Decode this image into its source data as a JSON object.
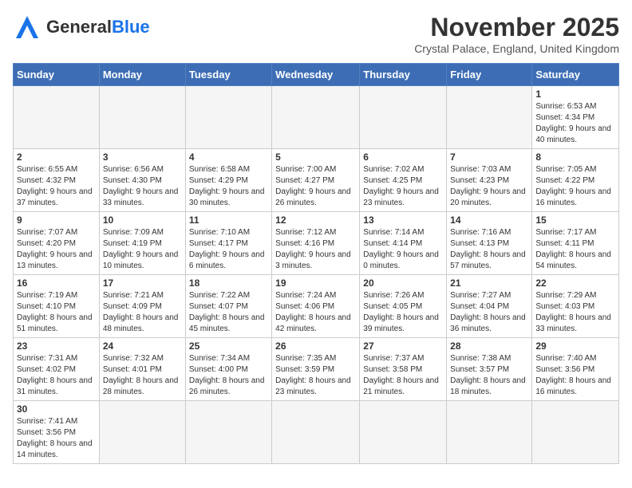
{
  "header": {
    "logo_general": "General",
    "logo_blue": "Blue",
    "month_title": "November 2025",
    "subtitle": "Crystal Palace, England, United Kingdom"
  },
  "days_of_week": [
    "Sunday",
    "Monday",
    "Tuesday",
    "Wednesday",
    "Thursday",
    "Friday",
    "Saturday"
  ],
  "weeks": [
    [
      {
        "day": "",
        "info": ""
      },
      {
        "day": "",
        "info": ""
      },
      {
        "day": "",
        "info": ""
      },
      {
        "day": "",
        "info": ""
      },
      {
        "day": "",
        "info": ""
      },
      {
        "day": "",
        "info": ""
      },
      {
        "day": "1",
        "info": "Sunrise: 6:53 AM\nSunset: 4:34 PM\nDaylight: 9 hours and 40 minutes."
      }
    ],
    [
      {
        "day": "2",
        "info": "Sunrise: 6:55 AM\nSunset: 4:32 PM\nDaylight: 9 hours and 37 minutes."
      },
      {
        "day": "3",
        "info": "Sunrise: 6:56 AM\nSunset: 4:30 PM\nDaylight: 9 hours and 33 minutes."
      },
      {
        "day": "4",
        "info": "Sunrise: 6:58 AM\nSunset: 4:29 PM\nDaylight: 9 hours and 30 minutes."
      },
      {
        "day": "5",
        "info": "Sunrise: 7:00 AM\nSunset: 4:27 PM\nDaylight: 9 hours and 26 minutes."
      },
      {
        "day": "6",
        "info": "Sunrise: 7:02 AM\nSunset: 4:25 PM\nDaylight: 9 hours and 23 minutes."
      },
      {
        "day": "7",
        "info": "Sunrise: 7:03 AM\nSunset: 4:23 PM\nDaylight: 9 hours and 20 minutes."
      },
      {
        "day": "8",
        "info": "Sunrise: 7:05 AM\nSunset: 4:22 PM\nDaylight: 9 hours and 16 minutes."
      }
    ],
    [
      {
        "day": "9",
        "info": "Sunrise: 7:07 AM\nSunset: 4:20 PM\nDaylight: 9 hours and 13 minutes."
      },
      {
        "day": "10",
        "info": "Sunrise: 7:09 AM\nSunset: 4:19 PM\nDaylight: 9 hours and 10 minutes."
      },
      {
        "day": "11",
        "info": "Sunrise: 7:10 AM\nSunset: 4:17 PM\nDaylight: 9 hours and 6 minutes."
      },
      {
        "day": "12",
        "info": "Sunrise: 7:12 AM\nSunset: 4:16 PM\nDaylight: 9 hours and 3 minutes."
      },
      {
        "day": "13",
        "info": "Sunrise: 7:14 AM\nSunset: 4:14 PM\nDaylight: 9 hours and 0 minutes."
      },
      {
        "day": "14",
        "info": "Sunrise: 7:16 AM\nSunset: 4:13 PM\nDaylight: 8 hours and 57 minutes."
      },
      {
        "day": "15",
        "info": "Sunrise: 7:17 AM\nSunset: 4:11 PM\nDaylight: 8 hours and 54 minutes."
      }
    ],
    [
      {
        "day": "16",
        "info": "Sunrise: 7:19 AM\nSunset: 4:10 PM\nDaylight: 8 hours and 51 minutes."
      },
      {
        "day": "17",
        "info": "Sunrise: 7:21 AM\nSunset: 4:09 PM\nDaylight: 8 hours and 48 minutes."
      },
      {
        "day": "18",
        "info": "Sunrise: 7:22 AM\nSunset: 4:07 PM\nDaylight: 8 hours and 45 minutes."
      },
      {
        "day": "19",
        "info": "Sunrise: 7:24 AM\nSunset: 4:06 PM\nDaylight: 8 hours and 42 minutes."
      },
      {
        "day": "20",
        "info": "Sunrise: 7:26 AM\nSunset: 4:05 PM\nDaylight: 8 hours and 39 minutes."
      },
      {
        "day": "21",
        "info": "Sunrise: 7:27 AM\nSunset: 4:04 PM\nDaylight: 8 hours and 36 minutes."
      },
      {
        "day": "22",
        "info": "Sunrise: 7:29 AM\nSunset: 4:03 PM\nDaylight: 8 hours and 33 minutes."
      }
    ],
    [
      {
        "day": "23",
        "info": "Sunrise: 7:31 AM\nSunset: 4:02 PM\nDaylight: 8 hours and 31 minutes."
      },
      {
        "day": "24",
        "info": "Sunrise: 7:32 AM\nSunset: 4:01 PM\nDaylight: 8 hours and 28 minutes."
      },
      {
        "day": "25",
        "info": "Sunrise: 7:34 AM\nSunset: 4:00 PM\nDaylight: 8 hours and 26 minutes."
      },
      {
        "day": "26",
        "info": "Sunrise: 7:35 AM\nSunset: 3:59 PM\nDaylight: 8 hours and 23 minutes."
      },
      {
        "day": "27",
        "info": "Sunrise: 7:37 AM\nSunset: 3:58 PM\nDaylight: 8 hours and 21 minutes."
      },
      {
        "day": "28",
        "info": "Sunrise: 7:38 AM\nSunset: 3:57 PM\nDaylight: 8 hours and 18 minutes."
      },
      {
        "day": "29",
        "info": "Sunrise: 7:40 AM\nSunset: 3:56 PM\nDaylight: 8 hours and 16 minutes."
      }
    ],
    [
      {
        "day": "30",
        "info": "Sunrise: 7:41 AM\nSunset: 3:56 PM\nDaylight: 8 hours and 14 minutes."
      },
      {
        "day": "",
        "info": ""
      },
      {
        "day": "",
        "info": ""
      },
      {
        "day": "",
        "info": ""
      },
      {
        "day": "",
        "info": ""
      },
      {
        "day": "",
        "info": ""
      },
      {
        "day": "",
        "info": ""
      }
    ]
  ]
}
